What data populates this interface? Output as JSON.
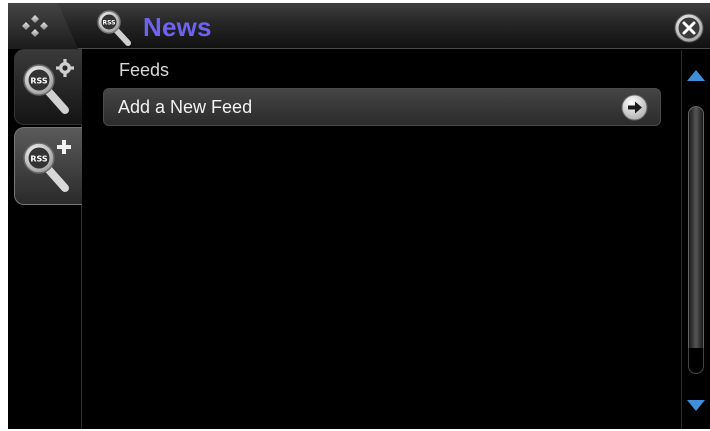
{
  "header": {
    "title": "News",
    "title_color": "#6e63f0",
    "home_icon": "home-diamond-icon",
    "app_icon": "rss-magnifier-icon",
    "close_icon": "close-icon",
    "rss_badge_text": "RSS"
  },
  "side_tabs": [
    {
      "name": "manage-feeds",
      "icon": "rss-settings-icon",
      "selected": false
    },
    {
      "name": "add-feed",
      "icon": "rss-add-icon",
      "selected": true
    }
  ],
  "main": {
    "section_label": "Feeds",
    "items": [
      {
        "label": "Add a New Feed",
        "icon": "arrow-right-icon"
      }
    ]
  },
  "scrollbar": {
    "up_icon": "scroll-up-arrow-icon",
    "down_icon": "scroll-down-arrow-icon",
    "accent": "#3f8fd9"
  }
}
